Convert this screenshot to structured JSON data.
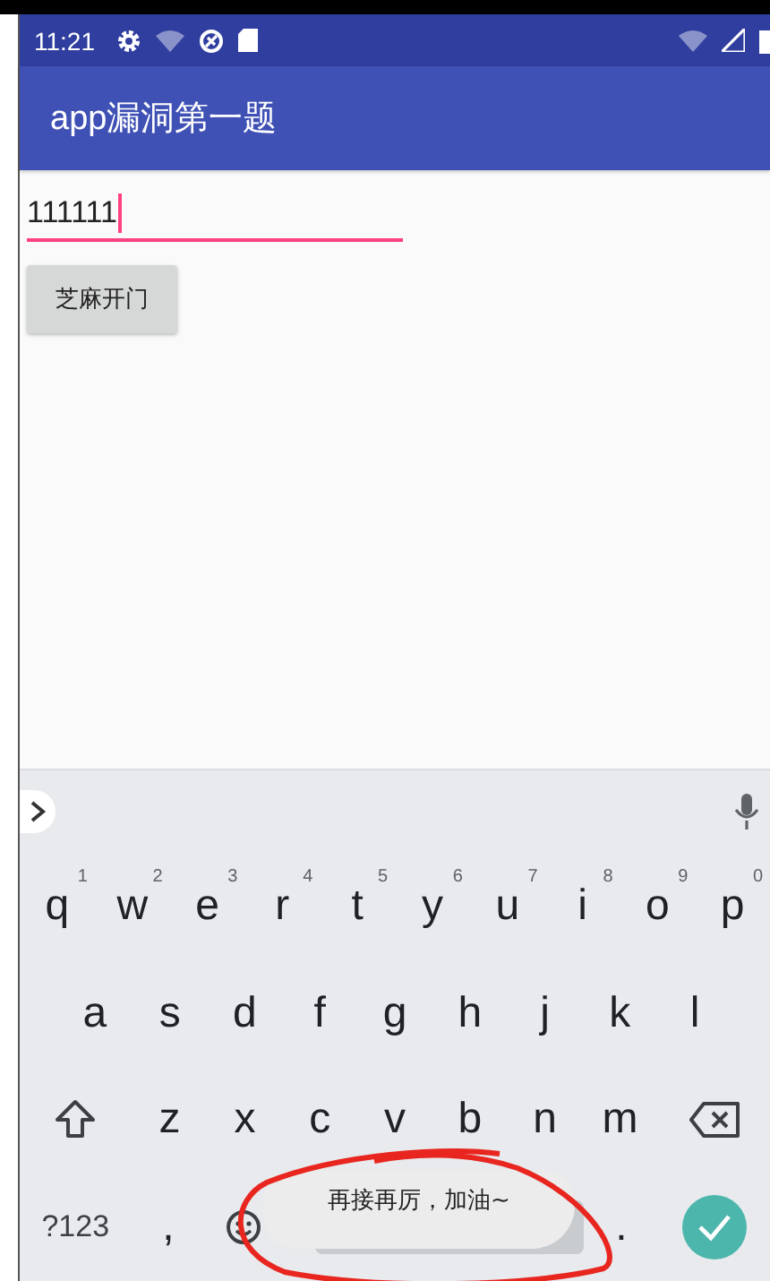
{
  "status_bar": {
    "time": "11:21"
  },
  "app_bar": {
    "title": "app漏洞第一题"
  },
  "input": {
    "value": "111111"
  },
  "button": {
    "label": "芝麻开门"
  },
  "keyboard": {
    "top_row": [
      {
        "kind": "letter",
        "label": "q",
        "hint": "1"
      },
      {
        "kind": "letter",
        "label": "w",
        "hint": "2"
      },
      {
        "kind": "letter",
        "label": "e",
        "hint": "3"
      },
      {
        "kind": "letter",
        "label": "r",
        "hint": "4"
      },
      {
        "kind": "letter",
        "label": "t",
        "hint": "5"
      },
      {
        "kind": "letter",
        "label": "y",
        "hint": "6"
      },
      {
        "kind": "letter",
        "label": "u",
        "hint": "7"
      },
      {
        "kind": "letter",
        "label": "i",
        "hint": "8"
      },
      {
        "kind": "letter",
        "label": "o",
        "hint": "9"
      },
      {
        "kind": "letter",
        "label": "p",
        "hint": "0"
      }
    ],
    "middle_row": [
      {
        "kind": "letter",
        "label": "a"
      },
      {
        "kind": "letter",
        "label": "s"
      },
      {
        "kind": "letter",
        "label": "d"
      },
      {
        "kind": "letter",
        "label": "f"
      },
      {
        "kind": "letter",
        "label": "g"
      },
      {
        "kind": "letter",
        "label": "h"
      },
      {
        "kind": "letter",
        "label": "j"
      },
      {
        "kind": "letter",
        "label": "k"
      },
      {
        "kind": "letter",
        "label": "l"
      }
    ],
    "lower_row": [
      {
        "kind": "shift"
      },
      {
        "kind": "letter",
        "label": "z"
      },
      {
        "kind": "letter",
        "label": "x"
      },
      {
        "kind": "letter",
        "label": "c"
      },
      {
        "kind": "letter",
        "label": "v"
      },
      {
        "kind": "letter",
        "label": "b"
      },
      {
        "kind": "letter",
        "label": "n"
      },
      {
        "kind": "letter",
        "label": "m"
      },
      {
        "kind": "backspace"
      }
    ],
    "bottom_row": [
      {
        "kind": "symbols",
        "label": "?123"
      },
      {
        "kind": "letter",
        "label": ","
      },
      {
        "kind": "emoji"
      },
      {
        "kind": "space"
      },
      {
        "kind": "letter",
        "label": "."
      },
      {
        "kind": "enter"
      }
    ]
  },
  "toast": {
    "text": "再接再厉，加油~"
  }
}
